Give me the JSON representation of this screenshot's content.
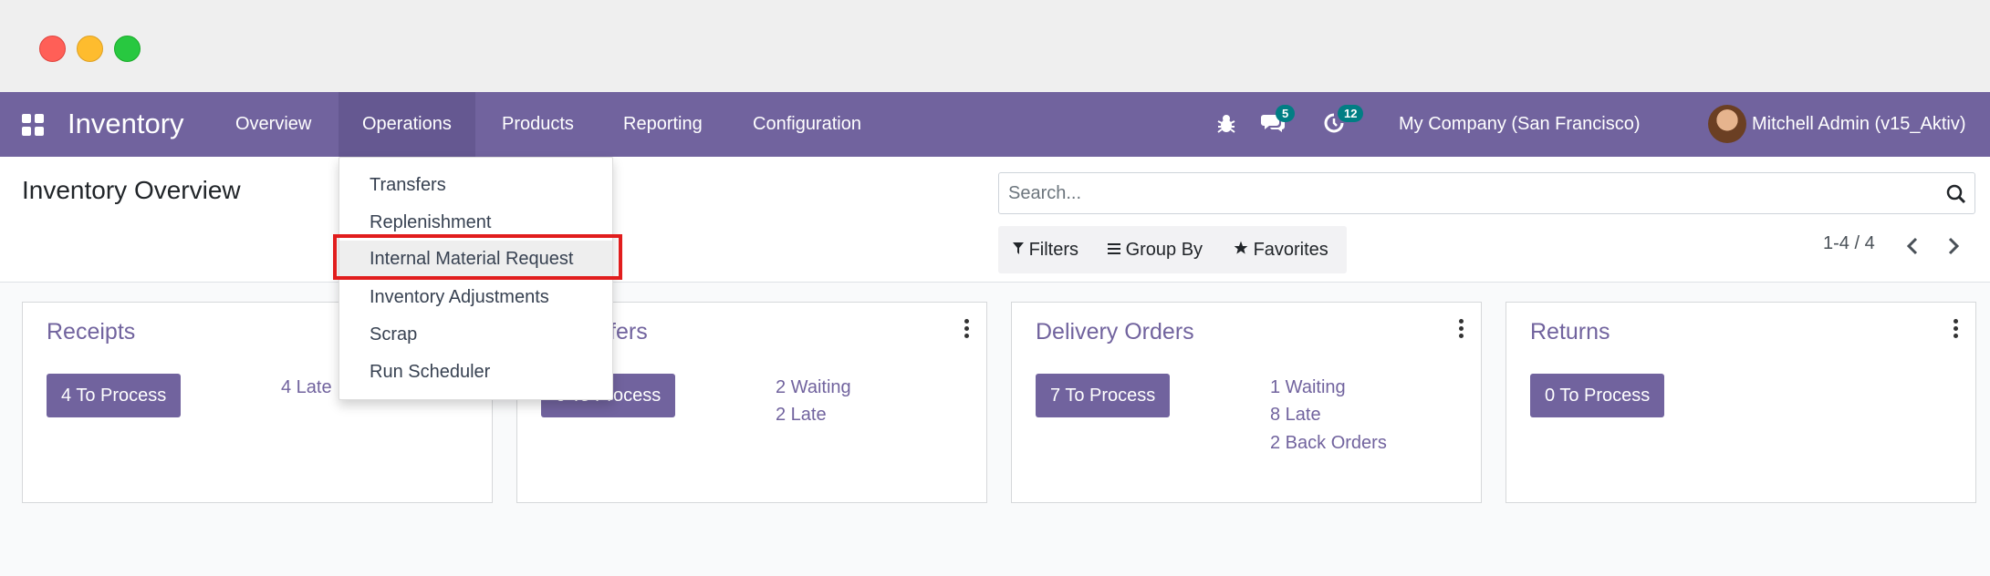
{
  "navbar": {
    "brand": "Inventory",
    "menu": [
      "Overview",
      "Operations",
      "Products",
      "Reporting",
      "Configuration"
    ],
    "messages_count": "5",
    "activities_count": "12",
    "company": "My Company (San Francisco)",
    "user": "Mitchell Admin (v15_Aktiv)"
  },
  "control": {
    "title": "Inventory Overview",
    "search_placeholder": "Search...",
    "filters": "Filters",
    "group_by": "Group By",
    "favorites": "Favorites",
    "pager": "1-4 / 4"
  },
  "dropdown": {
    "items": [
      "Transfers",
      "Replenishment",
      "Internal Material Request",
      "Inventory Adjustments",
      "Scrap",
      "Run Scheduler"
    ],
    "highlighted": "Internal Material Request"
  },
  "cards": [
    {
      "title": "Receipts",
      "button": "4 To Process",
      "stats": [
        "4 Late"
      ]
    },
    {
      "title": "l Transfers",
      "button": "0 To Process",
      "stats": [
        "2 Waiting",
        "2 Late"
      ]
    },
    {
      "title": "Delivery Orders",
      "button": "7 To Process",
      "stats": [
        "1 Waiting",
        "8 Late",
        "2 Back Orders"
      ]
    },
    {
      "title": "Returns",
      "button": "0 To Process",
      "stats": []
    }
  ],
  "colors": {
    "brand": "#71639e",
    "badge": "#017e84",
    "highlight_box": "#e11d1d"
  }
}
